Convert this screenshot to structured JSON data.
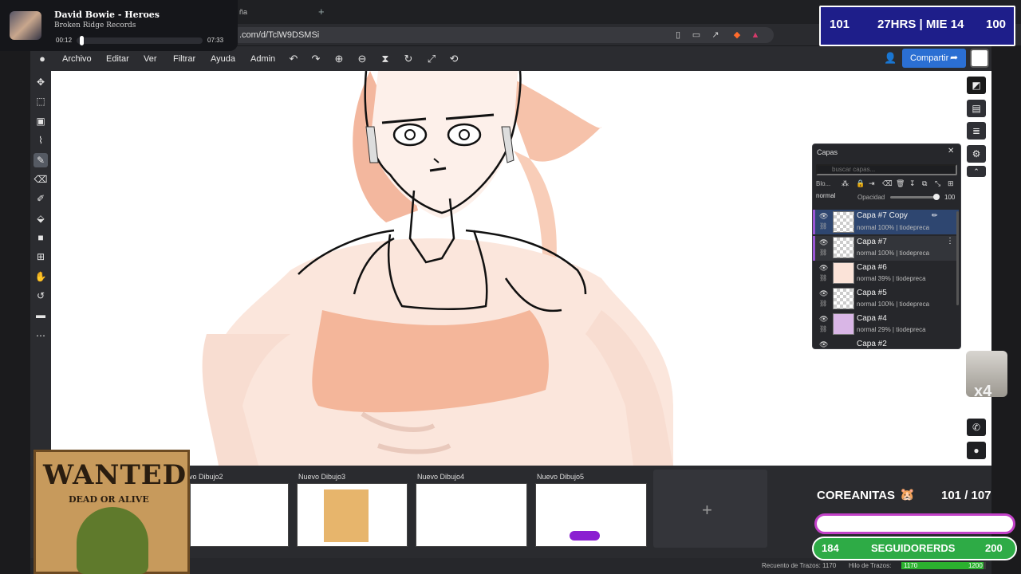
{
  "browser": {
    "tab_partial": "ña",
    "new_tab_icon": "plus-icon",
    "url": ".com/d/TclW9DSMSi"
  },
  "media": {
    "title": "David Bowie - Heroes",
    "artist": "Broken Ridge Records",
    "elapsed": "00:12",
    "total": "07:33",
    "progress": 0.027
  },
  "stream_top": {
    "left": "101",
    "middle": "27HRS | MIE 14",
    "right": "100"
  },
  "menu": {
    "items": [
      "Archivo",
      "Editar",
      "Ver",
      "Filtrar",
      "Ayuda",
      "Admin"
    ],
    "share_label": "Compartir"
  },
  "layers": {
    "title": "Capas",
    "search_placeholder": "buscar capas...",
    "lock_label": "Blo...",
    "blend_mode": "normal",
    "opacity_label": "Opacidad",
    "opacity_value": "100",
    "items": [
      {
        "name": "Capa #7 Copy",
        "meta": "normal 100% | tiodepreca"
      },
      {
        "name": "Capa #7",
        "meta": "normal 100% | tiodepreca"
      },
      {
        "name": "Capa #6",
        "meta": "normal 39% | tiodepreca"
      },
      {
        "name": "Capa #5",
        "meta": "normal 100% | tiodepreca"
      },
      {
        "name": "Capa #4",
        "meta": "normal 29% | tiodepreca"
      },
      {
        "name": "Capa #2",
        "meta": ""
      }
    ]
  },
  "documents": [
    {
      "label": "evo Dibujo2"
    },
    {
      "label": "Nuevo Dibujo3"
    },
    {
      "label": "Nuevo Dibujo4"
    },
    {
      "label": "Nuevo Dibujo5"
    }
  ],
  "status": {
    "stroke_count_label": "Recuento de Trazos: 1170",
    "stroke_thread_label": "Hilo de Trazos:",
    "progress_current": "1170",
    "progress_max": "1200",
    "progress_fraction": 0.975
  },
  "wanted": {
    "title": "WANTED",
    "subtitle": "DEAD OR ALIVE"
  },
  "goal": {
    "label": "COREANITAS",
    "icon": "🐹",
    "count": "101  /  107",
    "follow_left": "184",
    "follow_label": "SEGUIDORERDS",
    "follow_right": "200"
  },
  "cat_multiplier": "x4"
}
